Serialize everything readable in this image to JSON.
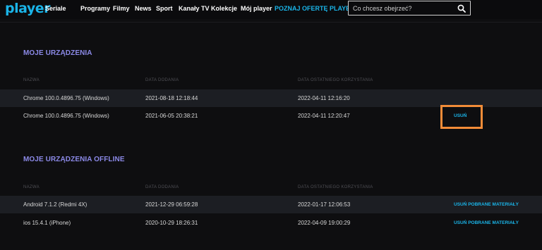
{
  "header": {
    "logo": "player",
    "nav": [
      "Seriale",
      "Programy",
      "Filmy",
      "News",
      "Sport",
      "Kanały TV",
      "Kolekcje",
      "Mój player"
    ],
    "promo": "POZNAJ OFERTĘ PLAYER",
    "search": {
      "placeholder": "Co chcesz obejrzeć?",
      "icon": "search-icon"
    }
  },
  "devices": {
    "title": "MOJE URZĄDZENIA",
    "columns": [
      "NAZWA",
      "DATA DODANIA",
      "DATA OSTATNIEGO KORZYSTANIA"
    ],
    "rows": [
      {
        "name": "Chrome 100.0.4896.75 (Windows)",
        "added": "2021-08-18 12:18:44",
        "last_used": "2022-04-11 12:16:20",
        "action": ""
      },
      {
        "name": "Chrome 100.0.4896.75 (Windows)",
        "added": "2021-06-05 20:38:21",
        "last_used": "2022-04-11 12:20:47",
        "action": "USUŃ"
      }
    ]
  },
  "offline": {
    "title": "MOJE URZĄDZENIA OFFLINE",
    "columns": [
      "NAZWA",
      "DATA DODANIA",
      "DATA OSTATNIEGO KORZYSTANIA"
    ],
    "rows": [
      {
        "name": "Android 7.1.2 (Redmi 4X)",
        "added": "2021-12-29 06:59:28",
        "last_used": "2022-01-17 12:06:53",
        "action": "USUŃ POBRANE MATERIAŁY"
      },
      {
        "name": "ios 15.4.1 (iPhone)",
        "added": "2020-10-29 18:26:31",
        "last_used": "2022-04-09 19:00:29",
        "action": "USUŃ POBRANE MATERIAŁY"
      }
    ]
  },
  "colors": {
    "accent": "#1ab4e8",
    "section_title": "#8c8ae8",
    "highlight": "#f28c38",
    "background": "#0e0e10",
    "row_shaded": "#1c1e23"
  }
}
